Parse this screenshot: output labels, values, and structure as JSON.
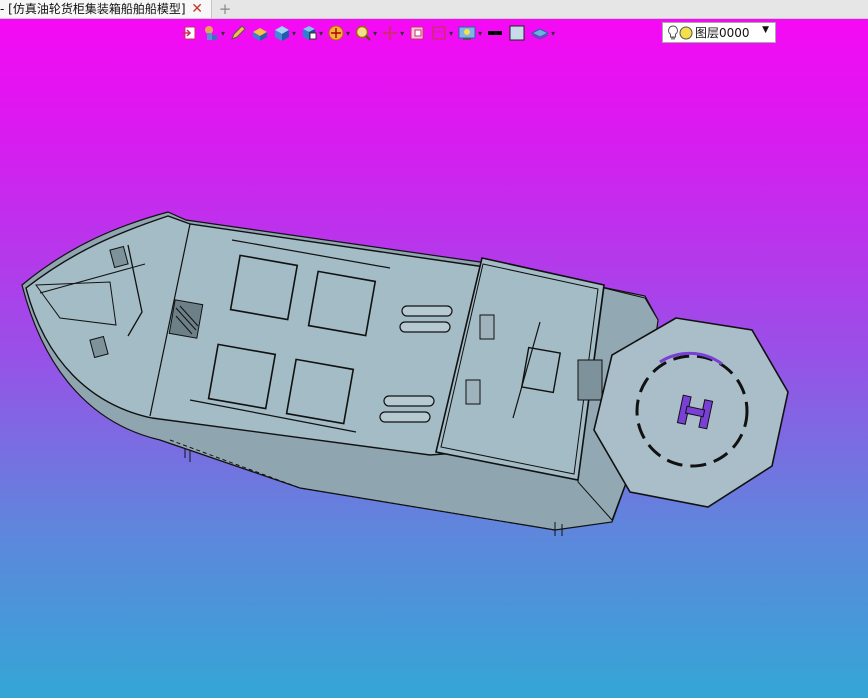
{
  "tab": {
    "title": "- [仿真油轮货柜集装箱船舶船模型]",
    "close": "✕",
    "new": "+"
  },
  "toolbar": {
    "icons": [
      "import-icon",
      "render-style-icon",
      "pen-icon",
      "solid-box-icon",
      "cube-view-icon",
      "view-cube-icon",
      "section-icon",
      "zoom-icon",
      "pan-icon",
      "select-frame-icon",
      "window-icon",
      "display-settings-icon",
      "line-color-icon",
      "fill-color-icon",
      "layer-stack-icon"
    ],
    "layer": {
      "name": "图层0000"
    }
  },
  "colors": {
    "bg_top": "#f609f4",
    "bg_bottom": "#34a6d6",
    "hull": "#a4bcc6",
    "outline": "#111111"
  },
  "model": {
    "name": "仿真油轮货柜集装箱船舶船模型",
    "helipad_mark": "H"
  }
}
